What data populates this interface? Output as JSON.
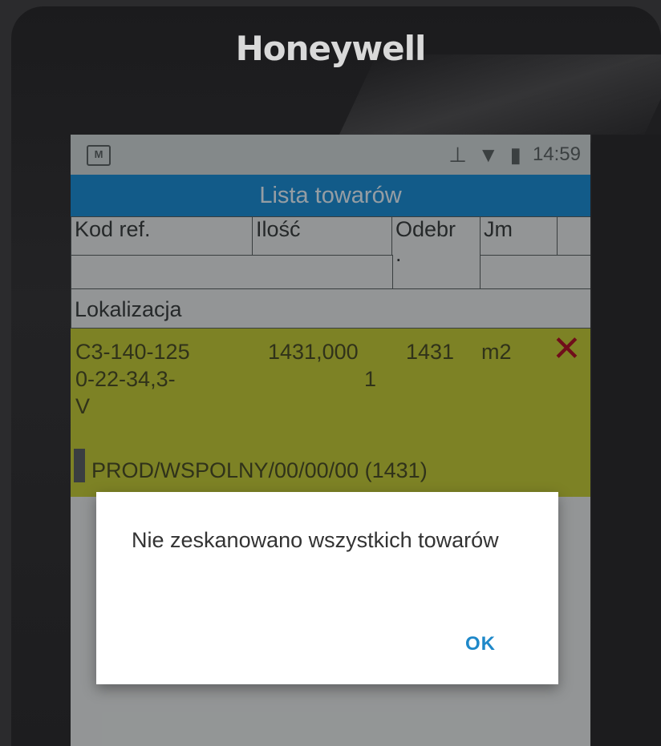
{
  "device": {
    "brand": "Honeywell"
  },
  "status_bar": {
    "time": "14:59",
    "icons": [
      "notification-icon",
      "usb-icon",
      "wifi-icon",
      "battery-icon"
    ]
  },
  "screen": {
    "title": "Lista towarów",
    "columns": {
      "kod_ref": "Kod ref.",
      "ilosc": "Ilość",
      "odebr": "Odebr",
      "odebr_dot": ".",
      "jm": "Jm",
      "lokalizacja": "Lokalizacja"
    },
    "items": [
      {
        "kod_ref_line1": "C3-140-125",
        "kod_ref_line2": "0-22-34,3-",
        "kod_ref_line3": "V",
        "ilosc_line1": "1431,000",
        "ilosc_line2": "1",
        "odebr": "1431",
        "jm": "m2",
        "lokalizacja": "PROD/WSPOLNY/00/00/00 (1431)"
      }
    ]
  },
  "dialog": {
    "message": "Nie zeskanowano wszystkich towarów",
    "ok_label": "OK"
  },
  "colors": {
    "title_bar": "#1d8fd6",
    "item_highlight": "#c4cb3a",
    "delete_x": "#b0152a",
    "ok_button": "#1e88c9"
  }
}
